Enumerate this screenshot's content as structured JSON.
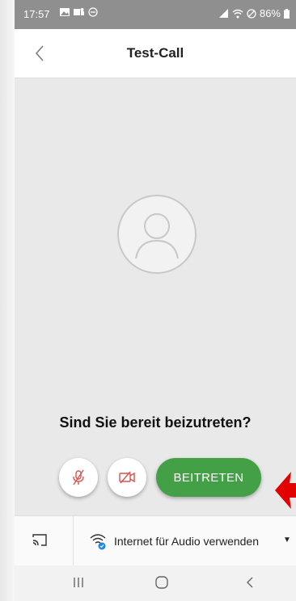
{
  "status_bar": {
    "time": "17:57",
    "battery": "86%"
  },
  "header": {
    "title": "Test-Call"
  },
  "main": {
    "prompt": "Sind Sie bereit beizutreten?",
    "join_label": "BEITRETEN"
  },
  "audio_bar": {
    "label": "Internet für Audio verwenden"
  },
  "colors": {
    "accent": "#43a047",
    "mute_red": "#d9534f",
    "arrow": "#e30000"
  },
  "icons": {
    "back": "chevron-left-icon",
    "mic_off": "mic-off-icon",
    "video_off": "video-off-icon",
    "cast": "cast-icon",
    "wifi": "wifi-icon",
    "dropdown": "dropdown-arrow-icon"
  }
}
